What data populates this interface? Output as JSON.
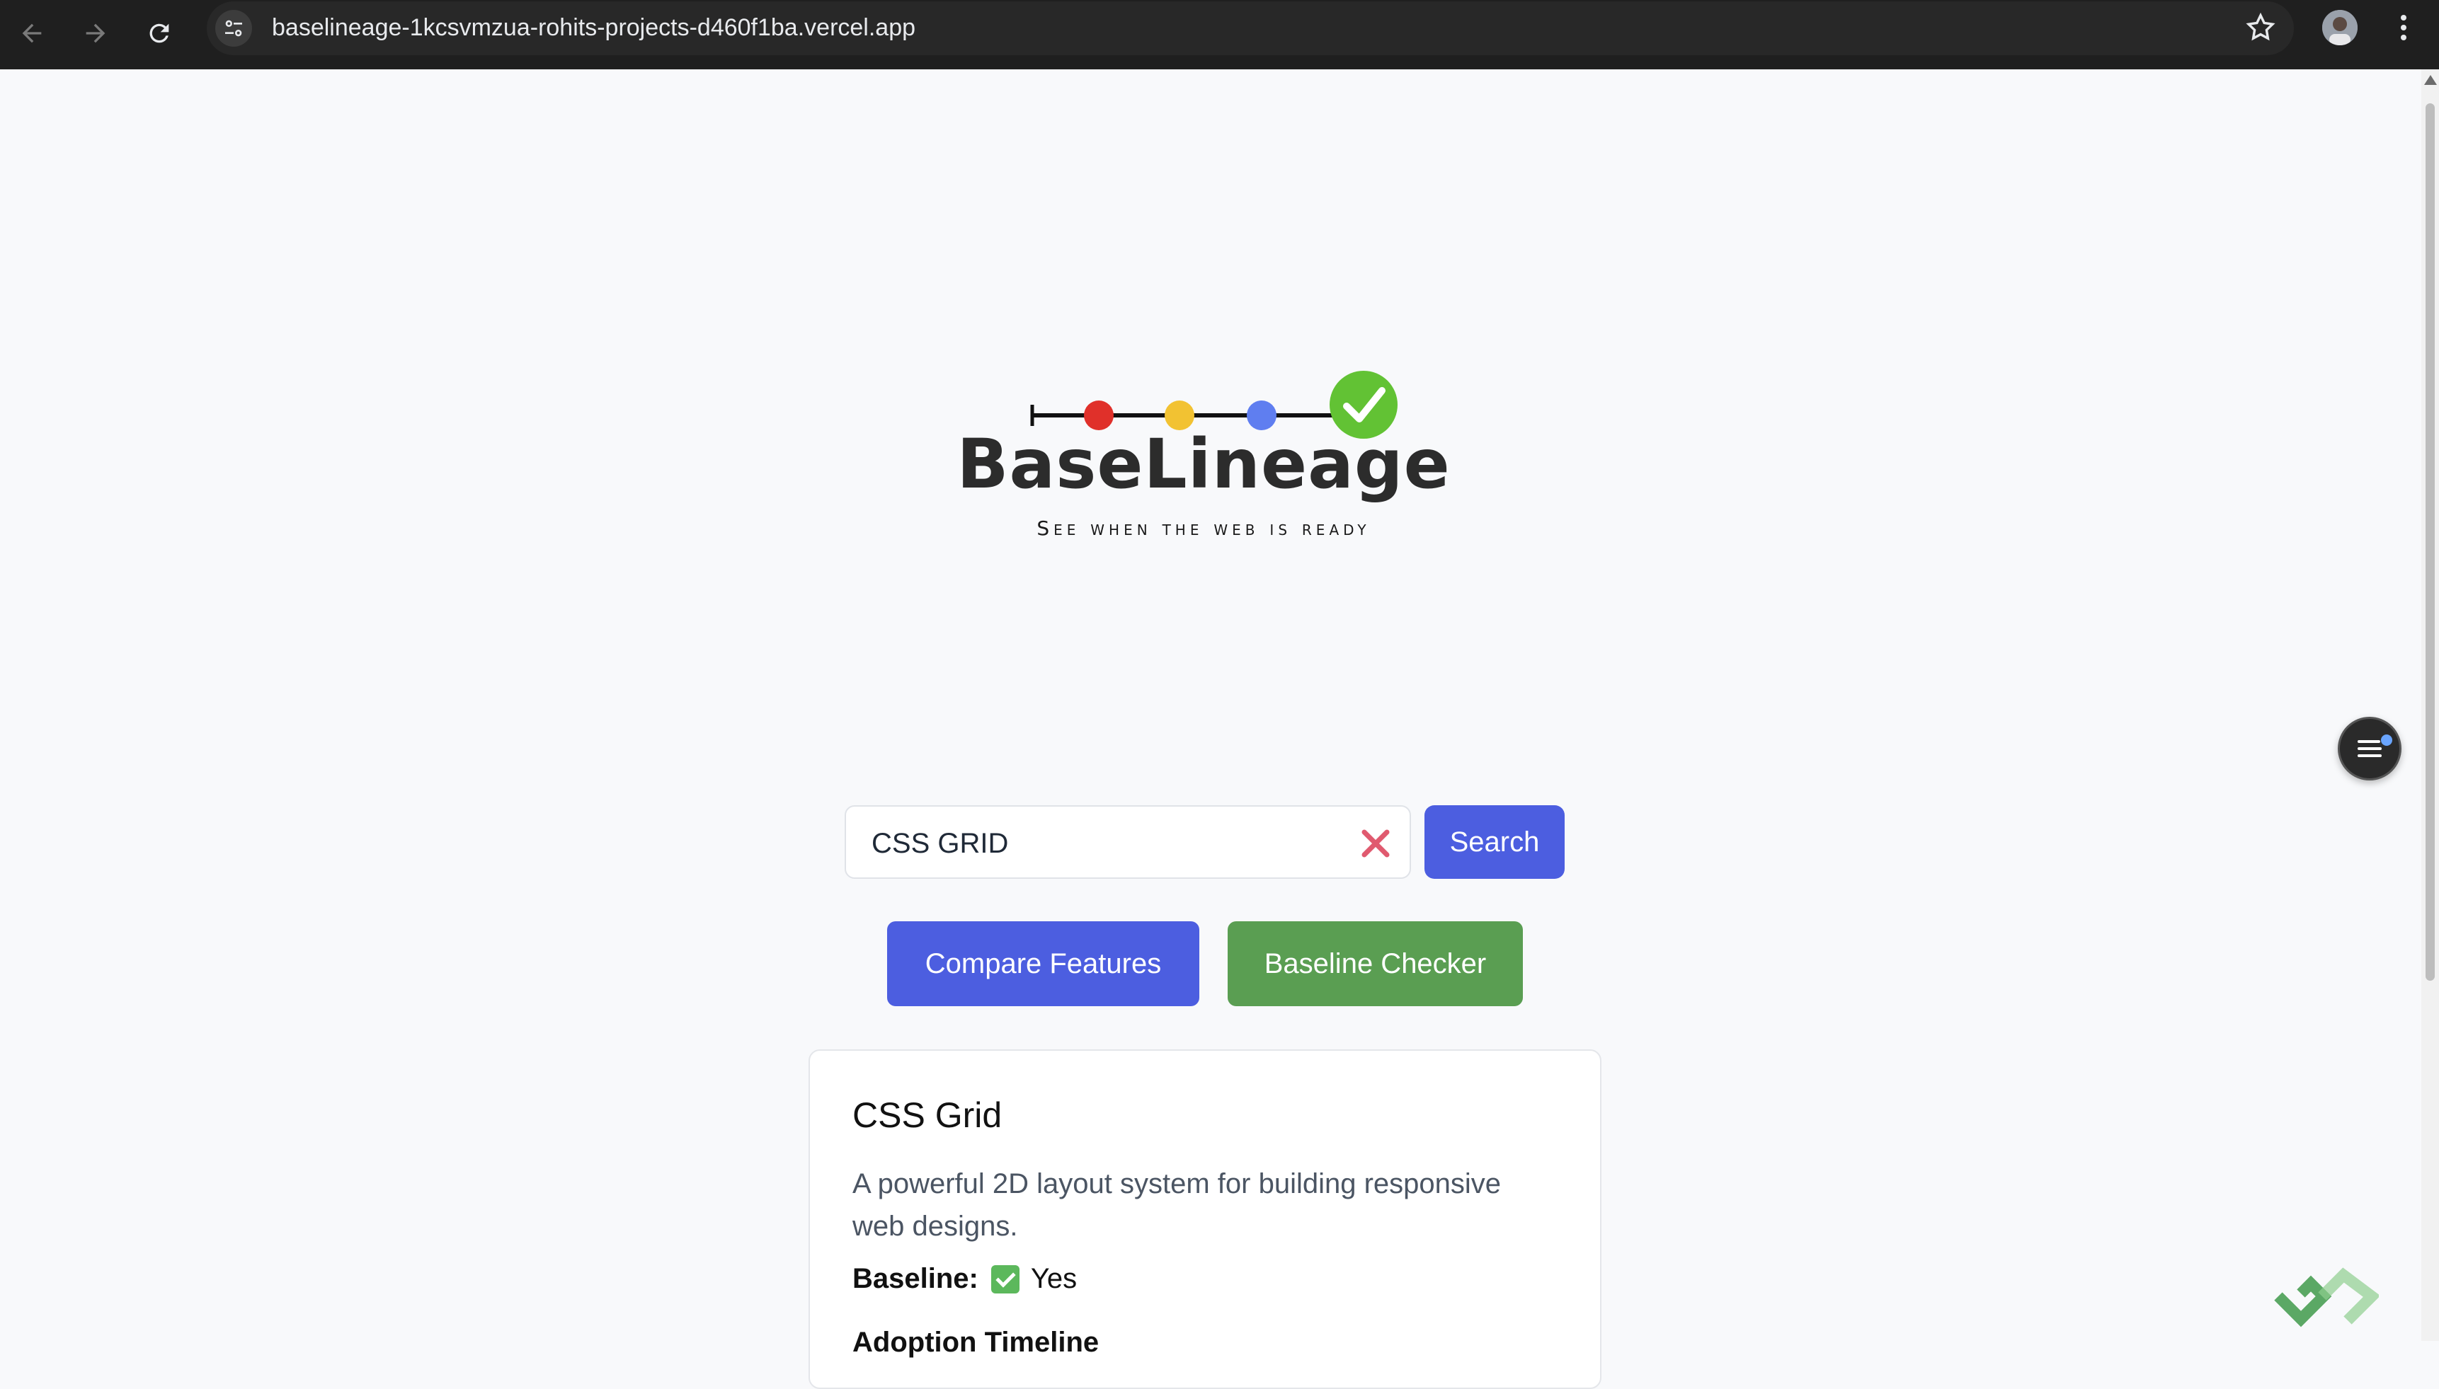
{
  "browser": {
    "url": "baselineage-1kcsvmzua-rohits-projects-d460f1ba.vercel.app",
    "icons": [
      "back-arrow-icon",
      "forward-arrow-icon",
      "reload-icon",
      "site-info-icon",
      "star-icon",
      "avatar",
      "kebab-menu-icon"
    ]
  },
  "logo": {
    "brand": "BaseLineage",
    "tagline": "See when the web is ready",
    "dot_colors": [
      "#e0302a",
      "#f2c232",
      "#5f7ef0"
    ],
    "check_color": "#62c234"
  },
  "search": {
    "value": "CSS GRID",
    "placeholder": "",
    "button_label": "Search"
  },
  "actions": {
    "compare_label": "Compare Features",
    "checker_label": "Baseline Checker"
  },
  "result": {
    "title": "CSS Grid",
    "description": "A powerful 2D layout system for building responsive web designs.",
    "baseline_label": "Baseline:",
    "baseline_value": "Yes",
    "timeline_label": "Adoption Timeline"
  },
  "colors": {
    "primary": "#4c5ee0",
    "success": "#5a9e52",
    "clear": "#e05a6f"
  }
}
